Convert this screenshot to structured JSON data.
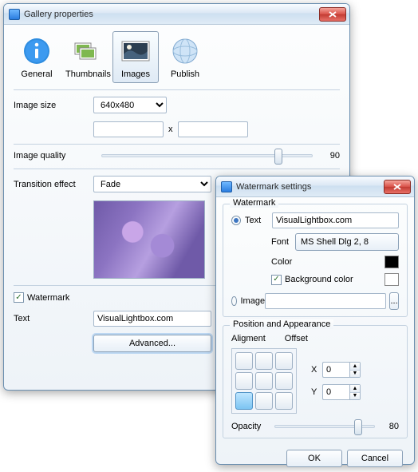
{
  "main": {
    "title": "Gallery properties",
    "tabs": [
      {
        "label": "General"
      },
      {
        "label": "Thumbnails"
      },
      {
        "label": "Images"
      },
      {
        "label": "Publish"
      }
    ],
    "imageSize": {
      "label": "Image size",
      "value": "640x480"
    },
    "dimW": "",
    "dimH": "",
    "dimX": "x",
    "quality": {
      "label": "Image quality",
      "value": "90",
      "pos": 82
    },
    "transition": {
      "label": "Transition effect",
      "value": "Fade"
    },
    "watermarkChk": "Watermark",
    "textLabel": "Text",
    "textValue": "VisualLightbox.com",
    "advanced": "Advanced..."
  },
  "wm": {
    "title": "Watermark settings",
    "group1": "Watermark",
    "radioText": "Text",
    "textValue": "VisualLightbox.com",
    "fontLabel": "Font",
    "fontValue": "MS Shell Dlg 2, 8",
    "colorLabel": "Color",
    "colorValue": "#000000",
    "bgChk": "Background color",
    "bgValue": "#ffffff",
    "radioImage": "Image",
    "imageValue": "",
    "browse": "...",
    "group2": "Position and Appearance",
    "alignLabel": "Aligment",
    "offsetLabel": "Offset",
    "x": "X",
    "xv": "0",
    "y": "Y",
    "yv": "0",
    "opacityLabel": "Opacity",
    "opacityValue": "80",
    "opacityPos": 80,
    "ok": "OK",
    "cancel": "Cancel"
  }
}
